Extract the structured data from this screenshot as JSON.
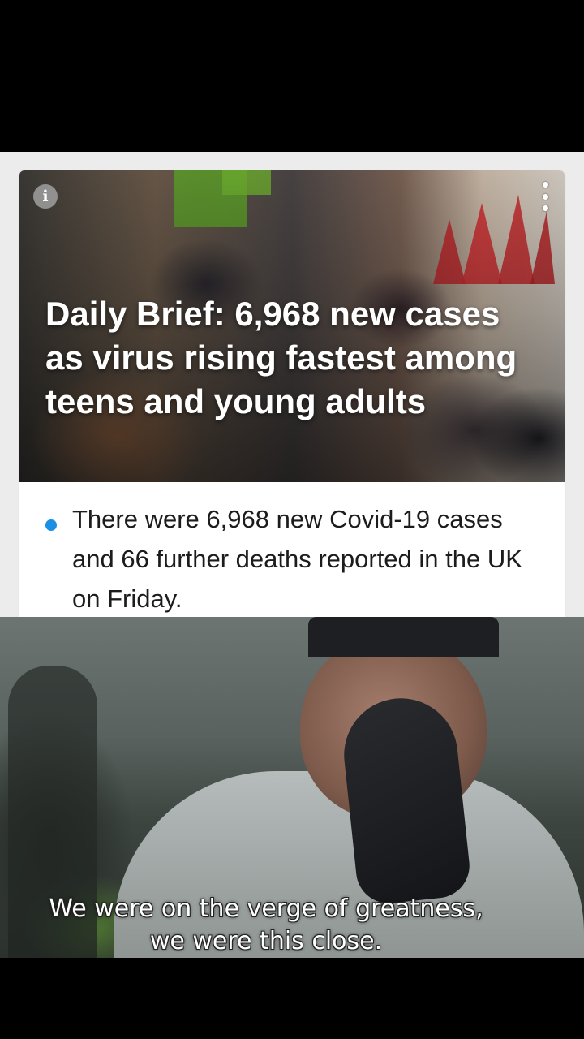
{
  "news_card": {
    "headline": "Daily Brief: 6,968 new cases as virus rising fastest among teens and young adults",
    "bullet": "There were 6,968 new Covid-19 cases and 66 further deaths reported in the UK on Friday.",
    "info_icon_glyph": "i",
    "icons": [
      "info-icon",
      "more-vertical-icon"
    ],
    "bullet_color": "#1a8fe3"
  },
  "meme": {
    "subtitle_line1": "We were on the verge of greatness,",
    "subtitle_line2": "we were this close."
  }
}
